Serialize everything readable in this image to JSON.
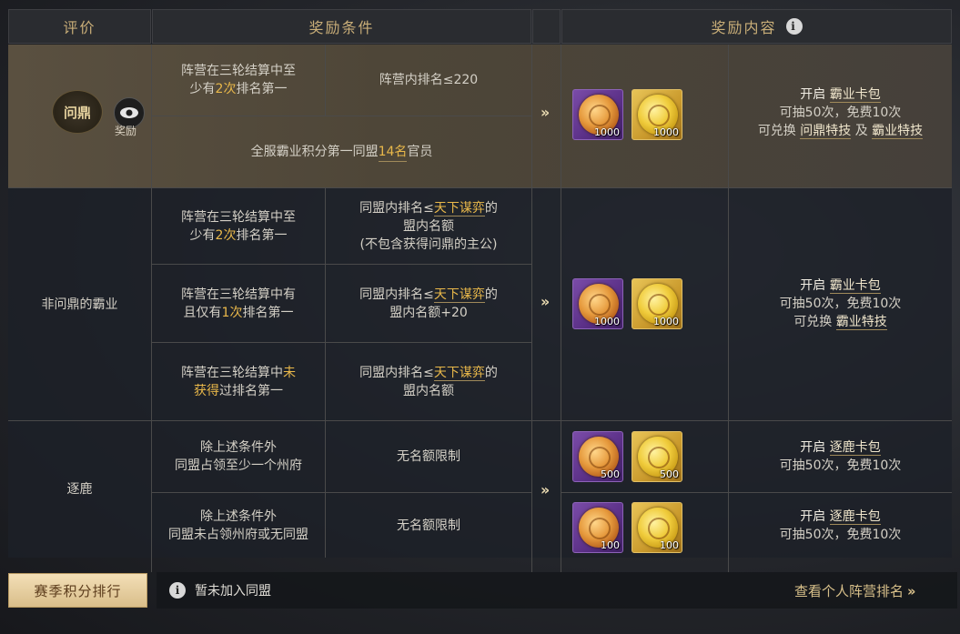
{
  "headers": {
    "rating": "评价",
    "condition": "奖励条件",
    "reward": "奖励内容"
  },
  "tier1": {
    "badge_label": "问鼎",
    "eye_label": "奖励",
    "cond_a_pre": "阵营在三轮结算中至",
    "cond_a_mid": "少有",
    "cond_a_hl": "2次",
    "cond_a_post": "排名第一",
    "rank_req": "阵营内排名≤220",
    "cond_b_pre": "全服霸业积分第一同盟",
    "cond_b_hl": "14名",
    "cond_b_post": "官员",
    "arrow": "››",
    "items": [
      {
        "qty": "1000",
        "icon": "copper-coin-icon"
      },
      {
        "qty": "1000",
        "icon": "gold-coin-icon"
      }
    ],
    "reward_line1_pre": "开启 ",
    "reward_line1_link": "霸业卡包",
    "reward_line2": "可抽50次，免费10次",
    "reward_line3_pre": "可兑换 ",
    "reward_line3_link1": "问鼎特技",
    "reward_line3_mid": " 及 ",
    "reward_line3_link2": "霸业特技"
  },
  "tier2": {
    "label": "非问鼎的霸业",
    "rows": [
      {
        "cond_l1": "阵营在三轮结算中至",
        "cond_l2_pre": "少有",
        "cond_l2_hl": "2次",
        "cond_l2_post": "排名第一",
        "req_l1_pre": "同盟内排名≤",
        "req_l1_link": "天下谋弈",
        "req_l1_post": "的",
        "req_l2": "盟内名额",
        "req_l3": "(不包含获得问鼎的主公)"
      },
      {
        "cond_l1": "阵营在三轮结算中有",
        "cond_l2_pre": "且仅有",
        "cond_l2_hl": "1次",
        "cond_l2_post": "排名第一",
        "req_l1_pre": "同盟内排名≤",
        "req_l1_link": "天下谋弈",
        "req_l1_post": "的",
        "req_l2": "盟内名额+20"
      },
      {
        "cond_l1_pre": "阵营在三轮结算中",
        "cond_l1_hl": "未",
        "cond_l2_hl": "获得",
        "cond_l2_post": "过排名第一",
        "req_l1_pre": "同盟内排名≤",
        "req_l1_link": "天下谋弈",
        "req_l1_post": "的",
        "req_l2": "盟内名额"
      }
    ],
    "arrow": "››",
    "items": [
      {
        "qty": "1000",
        "icon": "copper-coin-icon"
      },
      {
        "qty": "1000",
        "icon": "gold-coin-icon"
      }
    ],
    "reward_line1_pre": "开启 ",
    "reward_line1_link": "霸业卡包",
    "reward_line2": "可抽50次，免费10次",
    "reward_line3_pre": "可兑换 ",
    "reward_line3_link": "霸业特技"
  },
  "tier3": {
    "label": "逐鹿",
    "rows": [
      {
        "cond_l1": "除上述条件外",
        "cond_l2": "同盟占领至少一个州府",
        "req": "无名额限制",
        "items": [
          {
            "qty": "500",
            "icon": "copper-coin-icon"
          },
          {
            "qty": "500",
            "icon": "gold-coin-icon"
          }
        ],
        "reward_line1_pre": "开启 ",
        "reward_line1_link": "逐鹿卡包",
        "reward_line2": "可抽50次，免费10次"
      },
      {
        "cond_l1": "除上述条件外",
        "cond_l2": "同盟未占领州府或无同盟",
        "req": "无名额限制",
        "items": [
          {
            "qty": "100",
            "icon": "copper-coin-icon"
          },
          {
            "qty": "100",
            "icon": "gold-coin-icon"
          }
        ],
        "reward_line1_pre": "开启 ",
        "reward_line1_link": "逐鹿卡包",
        "reward_line2": "可抽50次，免费10次"
      }
    ],
    "arrow": "››"
  },
  "footer": {
    "rank_button": "赛季积分排行",
    "status_text": "暂未加入同盟",
    "personal_rank_link": "查看个人阵营排名",
    "personal_rank_arrow": "››"
  },
  "colors": {
    "highlight": "#e9b84a",
    "header_text": "#c9ae78",
    "button_bg": "#e8d1a3"
  }
}
